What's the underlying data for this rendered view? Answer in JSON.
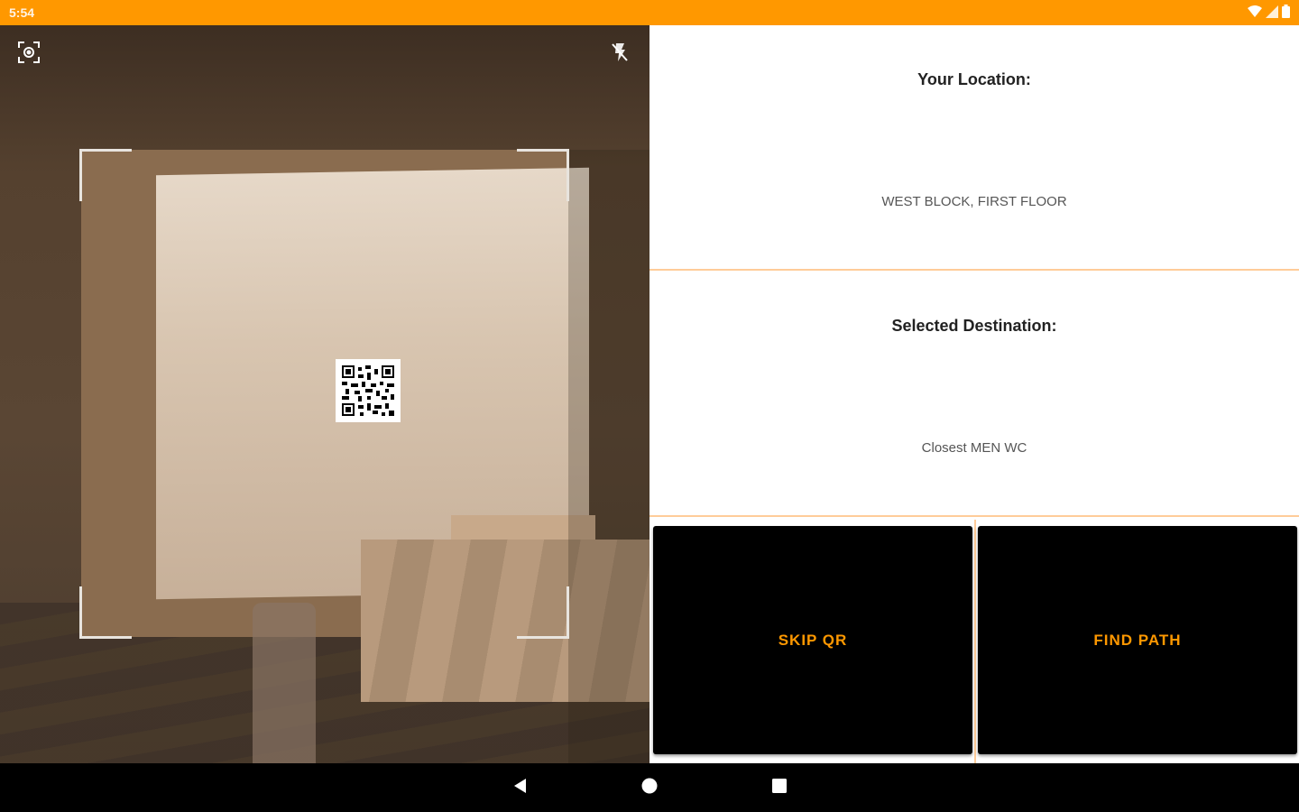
{
  "status_bar": {
    "time": "5:54",
    "icons": [
      "wifi-icon",
      "signal-icon",
      "battery-icon"
    ],
    "color": "#FF9800"
  },
  "camera": {
    "icons": {
      "focus": "focus-icon",
      "flash": "flash-off-icon"
    }
  },
  "location": {
    "title": "Your Location:",
    "value": "WEST BLOCK, FIRST FLOOR"
  },
  "destination": {
    "title": "Selected Destination:",
    "value": "Closest MEN WC"
  },
  "buttons": {
    "skip_label": "SKIP QR",
    "find_label": "FIND PATH",
    "text_color": "#FF9800",
    "background": "#000000"
  },
  "nav_bar": {
    "icons": [
      "back-icon",
      "home-icon",
      "recents-icon"
    ]
  }
}
